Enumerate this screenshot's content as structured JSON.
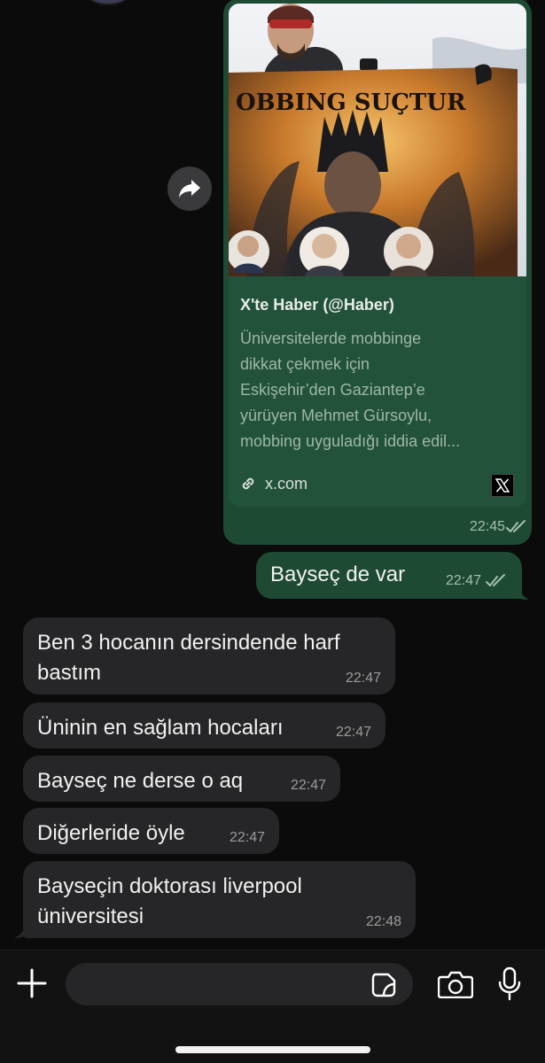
{
  "link_message": {
    "poster_text": "OBBING SUÇTUR",
    "card_title": "X'te Haber (@Haber)",
    "card_description_lines": [
      "Üniversitelerde mobbinge",
      "dikkat çekmek için",
      "Eskişehir’den Gaziantep’e",
      "yürüyen Mehmet Gürsoylu,",
      "mobbing uyguladığı iddia edil..."
    ],
    "link_domain": "x.com",
    "time": "22:45",
    "forward_icon": "forward-arrow-icon",
    "link_icon": "chain-link-icon",
    "site_logo_icon": "x-logo-icon",
    "read_icon": "double-check-icon"
  },
  "outgoing_messages": [
    {
      "text": "Bayseç de var",
      "time": "22:47"
    }
  ],
  "incoming_messages": [
    {
      "lines": [
        "Ben 3 hocanın dersindende harf",
        "bastım"
      ],
      "time": "22:47"
    },
    {
      "lines": [
        "Üninin en sağlam hocaları"
      ],
      "time": "22:47"
    },
    {
      "lines": [
        "Bayseç ne derse o aq"
      ],
      "time": "22:47"
    },
    {
      "lines": [
        "Diğerleride öyle"
      ],
      "time": "22:47"
    },
    {
      "lines": [
        "Bayseçin doktorası liverpool",
        "üniversitesi"
      ],
      "time": "22:48"
    }
  ],
  "composer": {
    "input_value": "",
    "input_placeholder": "",
    "icons": [
      "plus-icon",
      "sticker-icon",
      "camera-icon",
      "microphone-icon"
    ]
  },
  "colors": {
    "background": "#0b0b0b",
    "outgoing_bubble": "#1e4a34",
    "incoming_bubble": "#262628",
    "timestamp_outgoing": "#a4c0b1",
    "timestamp_incoming": "#9b9b9b"
  }
}
